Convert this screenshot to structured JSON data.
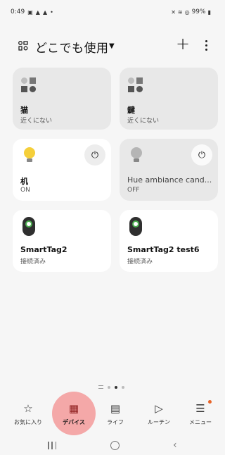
{
  "status_bar": {
    "time": "0:49",
    "battery": "99%"
  },
  "header": {
    "location": "どこでも使用",
    "add_label": "+"
  },
  "devices": [
    {
      "name": "猫",
      "status": "近くにない",
      "icon": "device-group-icon"
    },
    {
      "name": "鍵",
      "status": "近くにない",
      "icon": "device-group-icon"
    },
    {
      "name": "机",
      "status": "ON",
      "icon": "bulb-icon",
      "bulb_color": "#f5cf3a",
      "power": "⏻"
    },
    {
      "name": "Hue ambiance cand...",
      "status": "OFF",
      "icon": "bulb-icon",
      "bulb_color": "#b5b5b5",
      "power": "⏻"
    },
    {
      "name": "SmartTag2",
      "status": "接続済み",
      "icon": "smarttag-icon"
    },
    {
      "name": "SmartTag2 test6",
      "status": "接続済み",
      "icon": "smarttag-icon"
    }
  ],
  "bottom_nav": [
    {
      "label": "お気に入り",
      "icon": "☆"
    },
    {
      "label": "デバイス",
      "icon": "▦"
    },
    {
      "label": "ライフ",
      "icon": "▤"
    },
    {
      "label": "ルーチン",
      "icon": "▷"
    },
    {
      "label": "メニュー",
      "icon": "☰"
    }
  ],
  "colors": {
    "accent": "#f4a8a8",
    "badge": "#e8652a",
    "tag_ring": "#4caf50"
  }
}
